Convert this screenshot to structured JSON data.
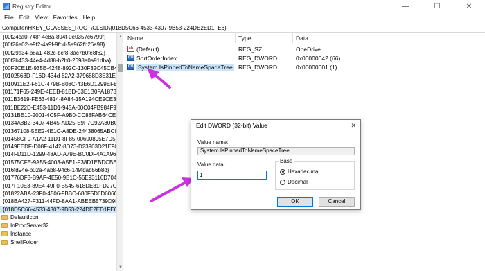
{
  "window": {
    "title": "Registry Editor",
    "minimize": "—",
    "maximize": "☐",
    "close": "✕"
  },
  "menu": [
    "File",
    "Edit",
    "View",
    "Favorites",
    "Help"
  ],
  "address": "Computer\\HKEY_CLASSES_ROOT\\CLSID\\{018D5C66-4533-4307-9B53-224DE2ED1FE6}",
  "tree": {
    "keys": [
      "{00f24ca0-748f-4e8a-894f-0e0357c6799f}",
      "{00f26e02-e9f2-4a9f-9fdd-5a962fb26a98}",
      "{00f29a34-b8a1-482c-bcf8-3ac7b0fe8f62}",
      "{00f2b433-44e4-4d88-b2b0-2698a0a91dba}",
      "{00F2CE1E-935E-4248-892C-130F32C45CB4}",
      "{0102563D-F16D-434d-82A2-379688D3E31E}",
      "{010911E2-F61C-479B-B08C-43E6D1299EFE}",
      "{01171F65-249E-4EEB-81BD-03E1B0FA1873}",
      "{011B3619-FE63-4814-8A84-15A194CE9CE3}",
      "{011BE22D-E453-11D1-945A-00C04FB984F9}",
      "{0131BE10-2001-4C5F-A9B0-CC88FAB64CE8}",
      "{0134A8B2-3407-4B45-AD25-E9F7C92A80BC}",
      "{01367108-5EE2-4E1C-A8DE-24438065ABC9}",
      "{01458CF0-A1A2-11D1-8F85-00600895E7D5}",
      "{0149EEDF-D08F-4142-8D73-D23903D21E90}",
      "{014FD11D-1299-48AD-A79E-BC0DF4A1A967}",
      "{01575CFE-9A55-4003-A5E1-F38D1EBDCBE1}",
      "{016fd94e-b02a-4ab8-94c6-149fdab56b8d}",
      "{01776DF3-B9AF-4E50-9B1C-56E93116D704}",
      "{017F10E3-89E4-49F0-B545-618DE31FD27C}",
      "{01822ABA-23F0-4506-9BBC-680F5D6D606C}",
      "{018BA427-F311-44FD-8AA1-ABEEB5739D9F}",
      "{018D5C66-4533-4307-9B53-224DE2ED1FE6}"
    ],
    "selected_index": 22,
    "subkeys": [
      "DefaultIcon",
      "InProcServer32",
      "Instance",
      "ShellFolder"
    ]
  },
  "values": {
    "headers": {
      "name": "Name",
      "type": "Type",
      "data": "Data"
    },
    "rows": [
      {
        "name": "(Default)",
        "type": "REG_SZ",
        "data": "OneDrive",
        "icon": "string-value-icon",
        "badge": "ab"
      },
      {
        "name": "SortOrderIndex",
        "type": "REG_DWORD",
        "data": "0x00000042 (66)",
        "icon": "dword-value-icon",
        "badge": "011"
      },
      {
        "name": "System.IsPinnedToNameSpaceTree",
        "type": "REG_DWORD",
        "data": "0x00000001 (1)",
        "icon": "dword-value-icon",
        "badge": "011"
      }
    ]
  },
  "dialog": {
    "title": "Edit DWORD (32-bit) Value",
    "close": "✕",
    "value_name_label": "Value name:",
    "value_name": "System.IsPinnedToNameSpaceTree",
    "value_data_label": "Value data:",
    "value_data": "1",
    "base_label": "Base",
    "base_options": [
      "Hexadecimal",
      "Decimal"
    ],
    "base_selected": "Hexadecimal",
    "ok": "OK",
    "cancel": "Cancel"
  },
  "colors": {
    "selection": "#cce4f7",
    "annotation_arrow": "#cc33e0",
    "focus": "#0078d7"
  }
}
